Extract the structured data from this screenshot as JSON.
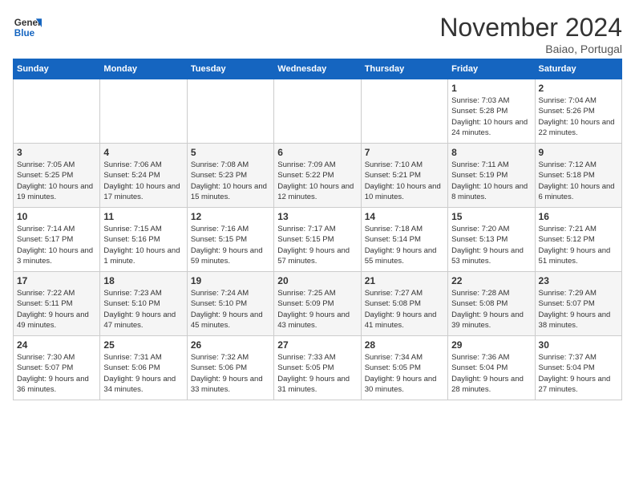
{
  "logo": {
    "line1": "General",
    "line2": "Blue"
  },
  "title": "November 2024",
  "location": "Baiao, Portugal",
  "days_of_week": [
    "Sunday",
    "Monday",
    "Tuesday",
    "Wednesday",
    "Thursday",
    "Friday",
    "Saturday"
  ],
  "weeks": [
    [
      {
        "num": "",
        "info": ""
      },
      {
        "num": "",
        "info": ""
      },
      {
        "num": "",
        "info": ""
      },
      {
        "num": "",
        "info": ""
      },
      {
        "num": "",
        "info": ""
      },
      {
        "num": "1",
        "info": "Sunrise: 7:03 AM\nSunset: 5:28 PM\nDaylight: 10 hours and 24 minutes."
      },
      {
        "num": "2",
        "info": "Sunrise: 7:04 AM\nSunset: 5:26 PM\nDaylight: 10 hours and 22 minutes."
      }
    ],
    [
      {
        "num": "3",
        "info": "Sunrise: 7:05 AM\nSunset: 5:25 PM\nDaylight: 10 hours and 19 minutes."
      },
      {
        "num": "4",
        "info": "Sunrise: 7:06 AM\nSunset: 5:24 PM\nDaylight: 10 hours and 17 minutes."
      },
      {
        "num": "5",
        "info": "Sunrise: 7:08 AM\nSunset: 5:23 PM\nDaylight: 10 hours and 15 minutes."
      },
      {
        "num": "6",
        "info": "Sunrise: 7:09 AM\nSunset: 5:22 PM\nDaylight: 10 hours and 12 minutes."
      },
      {
        "num": "7",
        "info": "Sunrise: 7:10 AM\nSunset: 5:21 PM\nDaylight: 10 hours and 10 minutes."
      },
      {
        "num": "8",
        "info": "Sunrise: 7:11 AM\nSunset: 5:19 PM\nDaylight: 10 hours and 8 minutes."
      },
      {
        "num": "9",
        "info": "Sunrise: 7:12 AM\nSunset: 5:18 PM\nDaylight: 10 hours and 6 minutes."
      }
    ],
    [
      {
        "num": "10",
        "info": "Sunrise: 7:14 AM\nSunset: 5:17 PM\nDaylight: 10 hours and 3 minutes."
      },
      {
        "num": "11",
        "info": "Sunrise: 7:15 AM\nSunset: 5:16 PM\nDaylight: 10 hours and 1 minute."
      },
      {
        "num": "12",
        "info": "Sunrise: 7:16 AM\nSunset: 5:15 PM\nDaylight: 9 hours and 59 minutes."
      },
      {
        "num": "13",
        "info": "Sunrise: 7:17 AM\nSunset: 5:15 PM\nDaylight: 9 hours and 57 minutes."
      },
      {
        "num": "14",
        "info": "Sunrise: 7:18 AM\nSunset: 5:14 PM\nDaylight: 9 hours and 55 minutes."
      },
      {
        "num": "15",
        "info": "Sunrise: 7:20 AM\nSunset: 5:13 PM\nDaylight: 9 hours and 53 minutes."
      },
      {
        "num": "16",
        "info": "Sunrise: 7:21 AM\nSunset: 5:12 PM\nDaylight: 9 hours and 51 minutes."
      }
    ],
    [
      {
        "num": "17",
        "info": "Sunrise: 7:22 AM\nSunset: 5:11 PM\nDaylight: 9 hours and 49 minutes."
      },
      {
        "num": "18",
        "info": "Sunrise: 7:23 AM\nSunset: 5:10 PM\nDaylight: 9 hours and 47 minutes."
      },
      {
        "num": "19",
        "info": "Sunrise: 7:24 AM\nSunset: 5:10 PM\nDaylight: 9 hours and 45 minutes."
      },
      {
        "num": "20",
        "info": "Sunrise: 7:25 AM\nSunset: 5:09 PM\nDaylight: 9 hours and 43 minutes."
      },
      {
        "num": "21",
        "info": "Sunrise: 7:27 AM\nSunset: 5:08 PM\nDaylight: 9 hours and 41 minutes."
      },
      {
        "num": "22",
        "info": "Sunrise: 7:28 AM\nSunset: 5:08 PM\nDaylight: 9 hours and 39 minutes."
      },
      {
        "num": "23",
        "info": "Sunrise: 7:29 AM\nSunset: 5:07 PM\nDaylight: 9 hours and 38 minutes."
      }
    ],
    [
      {
        "num": "24",
        "info": "Sunrise: 7:30 AM\nSunset: 5:07 PM\nDaylight: 9 hours and 36 minutes."
      },
      {
        "num": "25",
        "info": "Sunrise: 7:31 AM\nSunset: 5:06 PM\nDaylight: 9 hours and 34 minutes."
      },
      {
        "num": "26",
        "info": "Sunrise: 7:32 AM\nSunset: 5:06 PM\nDaylight: 9 hours and 33 minutes."
      },
      {
        "num": "27",
        "info": "Sunrise: 7:33 AM\nSunset: 5:05 PM\nDaylight: 9 hours and 31 minutes."
      },
      {
        "num": "28",
        "info": "Sunrise: 7:34 AM\nSunset: 5:05 PM\nDaylight: 9 hours and 30 minutes."
      },
      {
        "num": "29",
        "info": "Sunrise: 7:36 AM\nSunset: 5:04 PM\nDaylight: 9 hours and 28 minutes."
      },
      {
        "num": "30",
        "info": "Sunrise: 7:37 AM\nSunset: 5:04 PM\nDaylight: 9 hours and 27 minutes."
      }
    ]
  ]
}
